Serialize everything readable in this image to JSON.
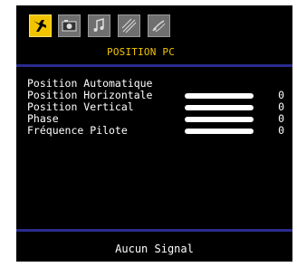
{
  "tabs": [
    {
      "name": "picture-settings",
      "icon": "airplane-icon",
      "active": true
    },
    {
      "name": "image",
      "icon": "camera-icon",
      "active": false
    },
    {
      "name": "sound",
      "icon": "music-note-icon",
      "active": false
    },
    {
      "name": "features",
      "icon": "sparkle-icon",
      "active": false
    },
    {
      "name": "installation",
      "icon": "satellite-dish-icon",
      "active": false
    }
  ],
  "section_title": "POSITION PC",
  "menu": {
    "auto_position": {
      "label": "Position Automatique"
    },
    "h_position": {
      "label": "Position Horizontale",
      "value": "0"
    },
    "v_position": {
      "label": "Position Vertical",
      "value": "0"
    },
    "phase": {
      "label": "Phase",
      "value": "0"
    },
    "pilot_freq": {
      "label": "Fréquence Pilote",
      "value": "0"
    }
  },
  "status": "Aucun Signal",
  "colors": {
    "background": "#000000",
    "accent": "#f2c400",
    "rule": "#2a2c8e",
    "text": "#ffffff"
  }
}
